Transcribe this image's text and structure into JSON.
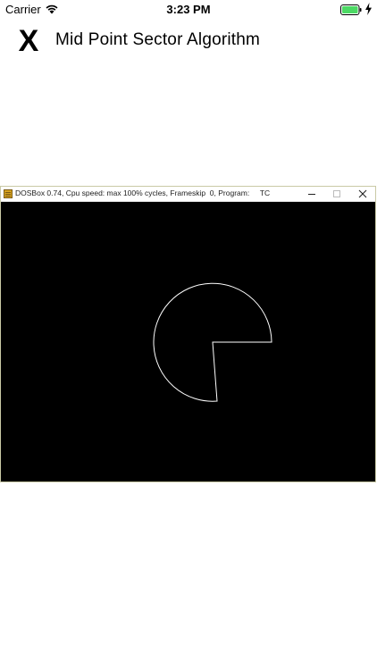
{
  "status_bar": {
    "carrier": "Carrier",
    "time": "3:23 PM",
    "battery_color": "#4cd964"
  },
  "header": {
    "close_label": "X",
    "title": "Mid Point Sector Algorithm"
  },
  "dosbox": {
    "title": "DOSBox 0.74, Cpu speed: max 100% cycles, Frameskip  0, Program:     TC",
    "screen_color": "#000000",
    "drawing_color": "#ffffff"
  }
}
